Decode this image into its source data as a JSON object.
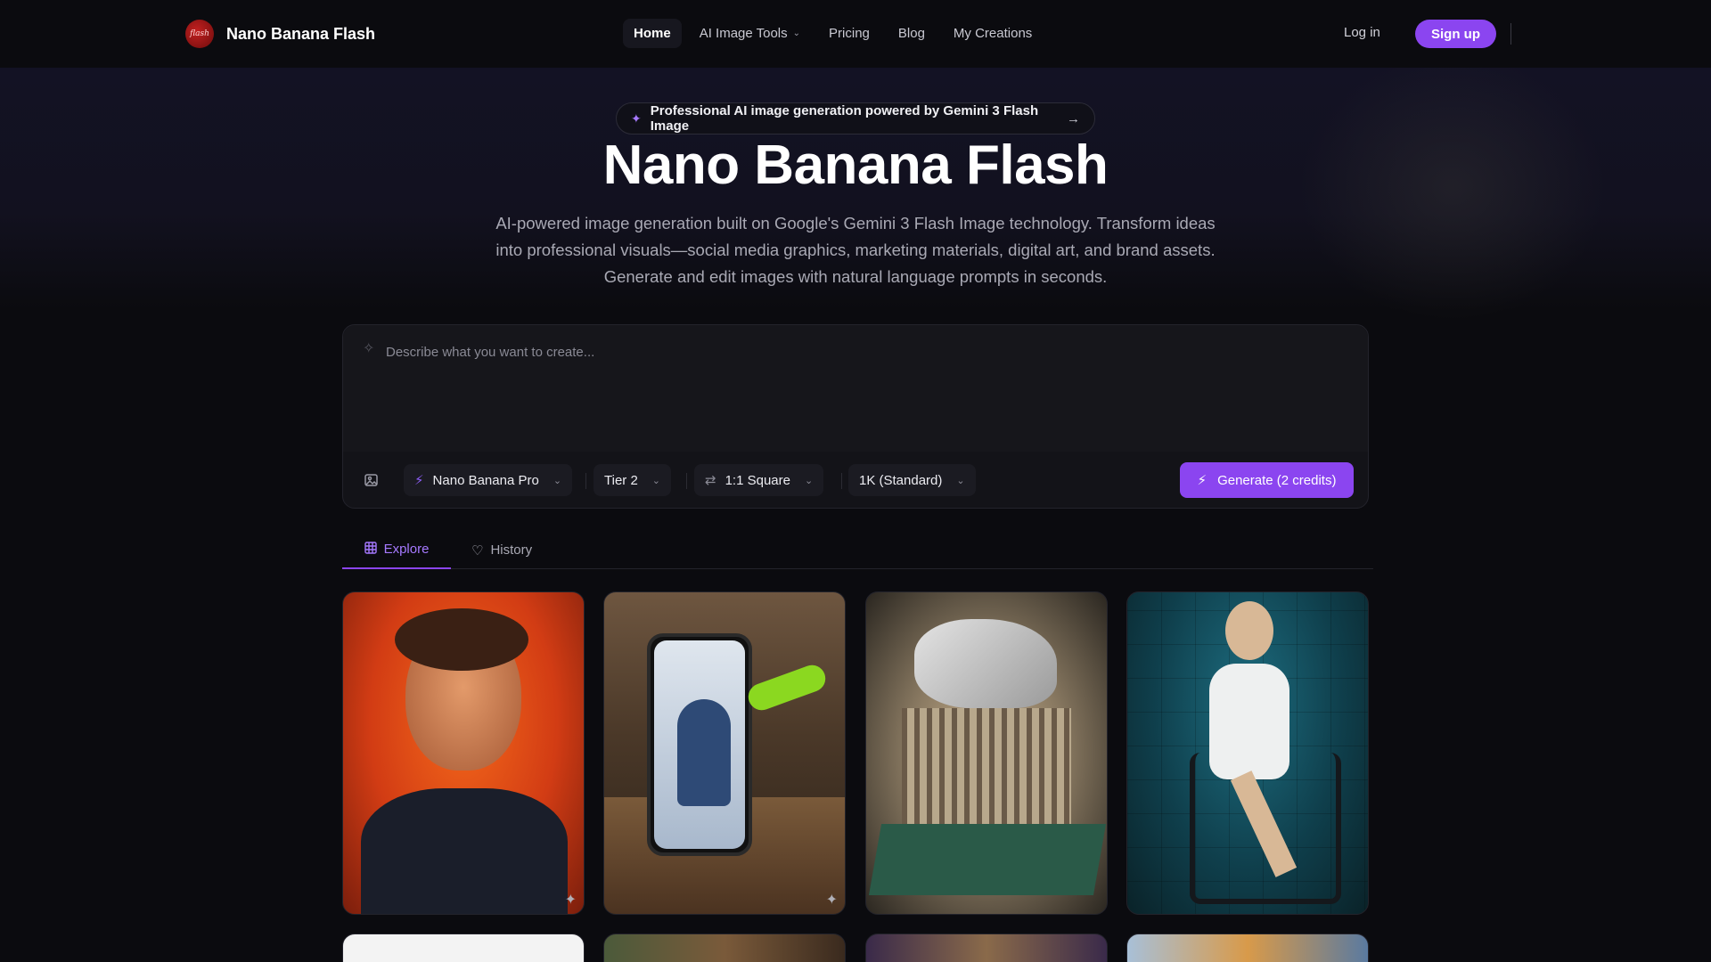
{
  "brand": {
    "name": "Nano Banana Flash",
    "logo_text": "flash"
  },
  "nav": {
    "links": [
      {
        "label": "Home",
        "active": true
      },
      {
        "label": "AI Image Tools",
        "has_dropdown": true
      },
      {
        "label": "Pricing"
      },
      {
        "label": "Blog"
      },
      {
        "label": "My Creations"
      }
    ],
    "login": "Log in",
    "signup": "Sign up"
  },
  "hero": {
    "badge": "Professional AI image generation powered by Gemini 3 Flash Image",
    "title": "Nano Banana Flash",
    "description": "AI-powered image generation built on Google's Gemini 3 Flash Image technology. Transform ideas into professional visuals—social media graphics, marketing materials, digital art, and brand assets. Generate and edit images with natural language prompts in seconds."
  },
  "prompt": {
    "placeholder": "Describe what you want to create...",
    "model": "Nano Banana Pro",
    "tier": "Tier 2",
    "aspect": "1:1 Square",
    "resolution": "1K (Standard)",
    "generate": "Generate (2 credits)"
  },
  "tabs": [
    {
      "label": "Explore",
      "active": true,
      "icon": "grid-icon"
    },
    {
      "label": "History",
      "active": false,
      "icon": "heart-icon"
    }
  ],
  "gallery": {
    "items": [
      {
        "name": "portrait-man-glasses-orange",
        "icon": "sparkle-icon"
      },
      {
        "name": "phone-girl-drink-pour",
        "icon": "sparkle-icon"
      },
      {
        "name": "architecture-model-construction"
      },
      {
        "name": "woman-white-dress-chair"
      },
      {
        "name": "white-card"
      },
      {
        "name": "warm-interior-portrait"
      },
      {
        "name": "triptych-portraits"
      },
      {
        "name": "blurred-colorful-scene"
      }
    ]
  },
  "colors": {
    "accent": "#8b45f0",
    "accent_light": "#a679ff",
    "background": "#0b0b0f"
  }
}
